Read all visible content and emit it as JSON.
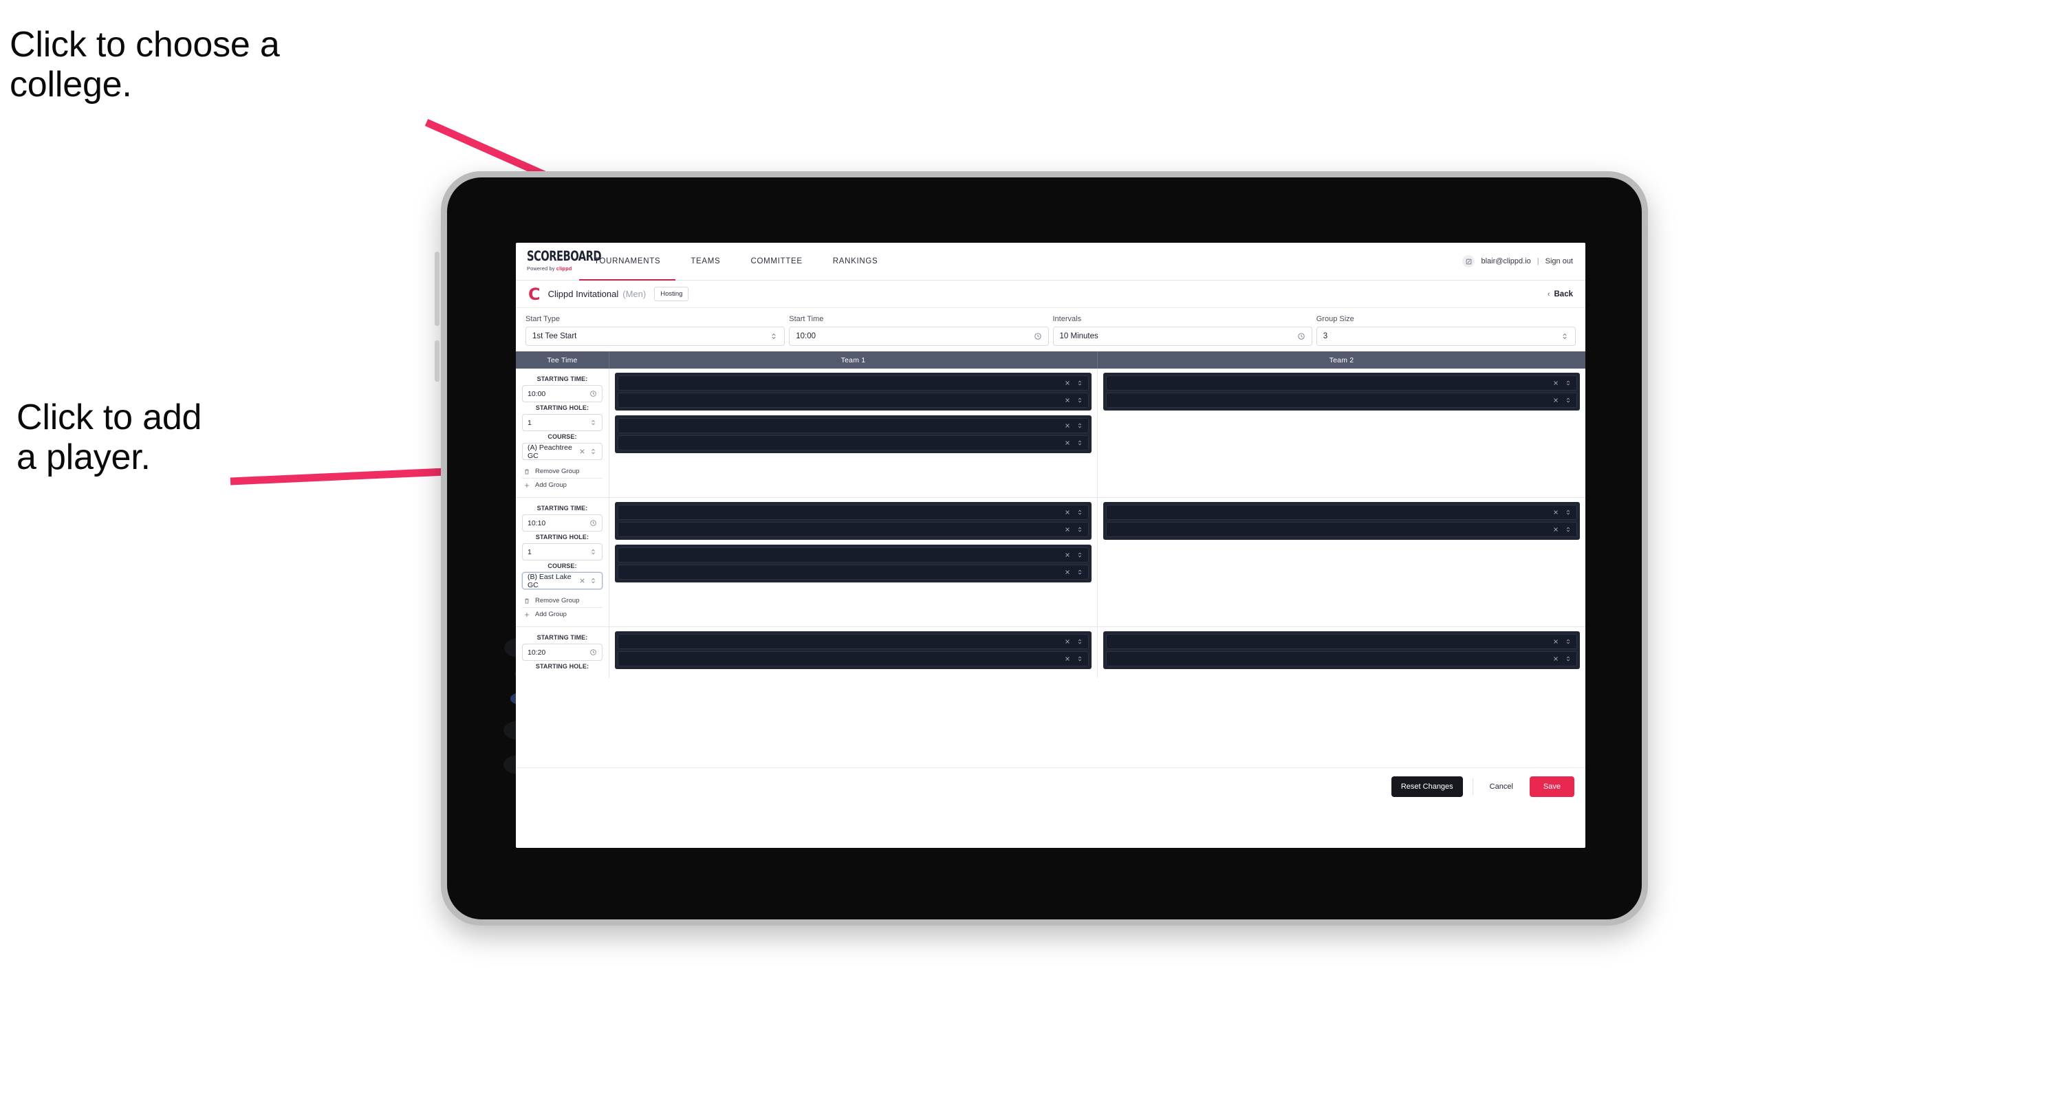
{
  "annotations": {
    "college": "Click to choose a\ncollege.",
    "player": "Click to add\na player.",
    "arrow_color": "#ef2d62"
  },
  "nav": {
    "brand_word": "SCOREBOARD",
    "brand_sub_prefix": "Powered by ",
    "brand_sub_name": "clippd",
    "tabs": [
      {
        "label": "TOURNAMENTS",
        "active": true
      },
      {
        "label": "TEAMS",
        "active": false
      },
      {
        "label": "COMMITTEE",
        "active": false
      },
      {
        "label": "RANKINGS",
        "active": false
      }
    ],
    "email": "blair@clippd.io",
    "separator": "|",
    "sign_out": "Sign out",
    "avatar_icon": "user-icon"
  },
  "tournament_bar": {
    "logo_letter": "C",
    "name": "Clippd Invitational",
    "gender": "(Men)",
    "status_badge": "Hosting",
    "back_label": "Back",
    "back_chevron": "‹"
  },
  "controls": [
    {
      "label": "Start Type",
      "value": "1st Tee Start",
      "icon": "stepper-icon"
    },
    {
      "label": "Start Time",
      "value": "10:00",
      "icon": "clock-icon"
    },
    {
      "label": "Intervals",
      "value": "10 Minutes",
      "icon": "clock-icon"
    },
    {
      "label": "Group Size",
      "value": "3",
      "icon": "stepper-icon"
    }
  ],
  "table": {
    "headers": [
      "Tee Time",
      "Team 1",
      "Team 2"
    ],
    "field_labels": {
      "time": "STARTING TIME:",
      "hole": "STARTING HOLE:",
      "course": "COURSE:"
    },
    "actions": {
      "remove": "Remove Group",
      "add": "Add Group"
    },
    "groups": [
      {
        "time": "10:00",
        "hole": "1",
        "course": "(A) Peachtree GC",
        "course_focused": false,
        "team1_blocks": [
          2,
          2
        ],
        "team2_blocks": [
          2
        ]
      },
      {
        "time": "10:10",
        "hole": "1",
        "course": "(B) East Lake GC",
        "course_focused": true,
        "team1_blocks": [
          2,
          2
        ],
        "team2_blocks": [
          2
        ]
      },
      {
        "time": "10:20",
        "hole": "",
        "course": "",
        "course_focused": false,
        "team1_blocks": [
          2
        ],
        "team2_blocks": [
          2
        ]
      }
    ]
  },
  "footer": {
    "reset_label": "Reset Changes",
    "cancel_label": "Cancel",
    "save_label": "Save",
    "save_color": "#e8284f"
  }
}
